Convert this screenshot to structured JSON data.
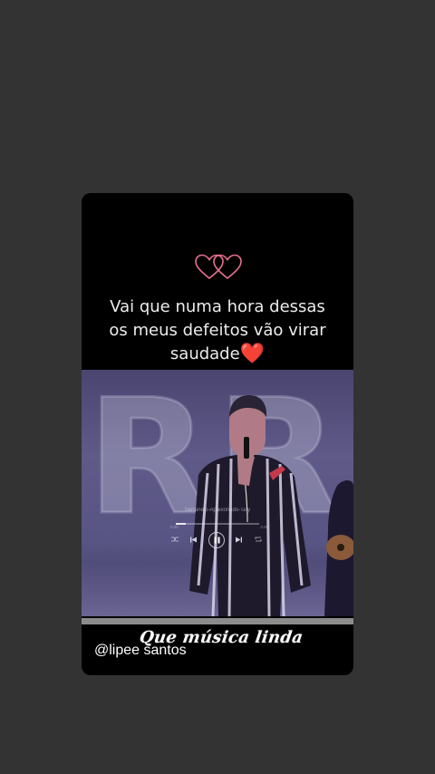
{
  "story": {
    "quote_lines": [
      "Vai que numa hora dessas",
      "os meus defeitos vão virar",
      "saudade"
    ],
    "quote_end_emoji": "❤️",
    "decor_icon": "double-heart-outline-icon",
    "accent_colors": {
      "heart_outline": "#e6708e",
      "heart_red": "#e3182b"
    }
  },
  "video": {
    "background_letters": "RRPI",
    "player": {
      "song_title": "Sertanejo-Apaixonado-Taty",
      "elapsed": "0:00",
      "total": "3:45",
      "progress": 0.12,
      "controls": [
        "shuffle-icon",
        "previous-icon",
        "pause-icon",
        "next-icon",
        "repeat-icon"
      ]
    }
  },
  "overlay": {
    "script_caption": "Que música linda",
    "handle": "@lipee santos"
  }
}
